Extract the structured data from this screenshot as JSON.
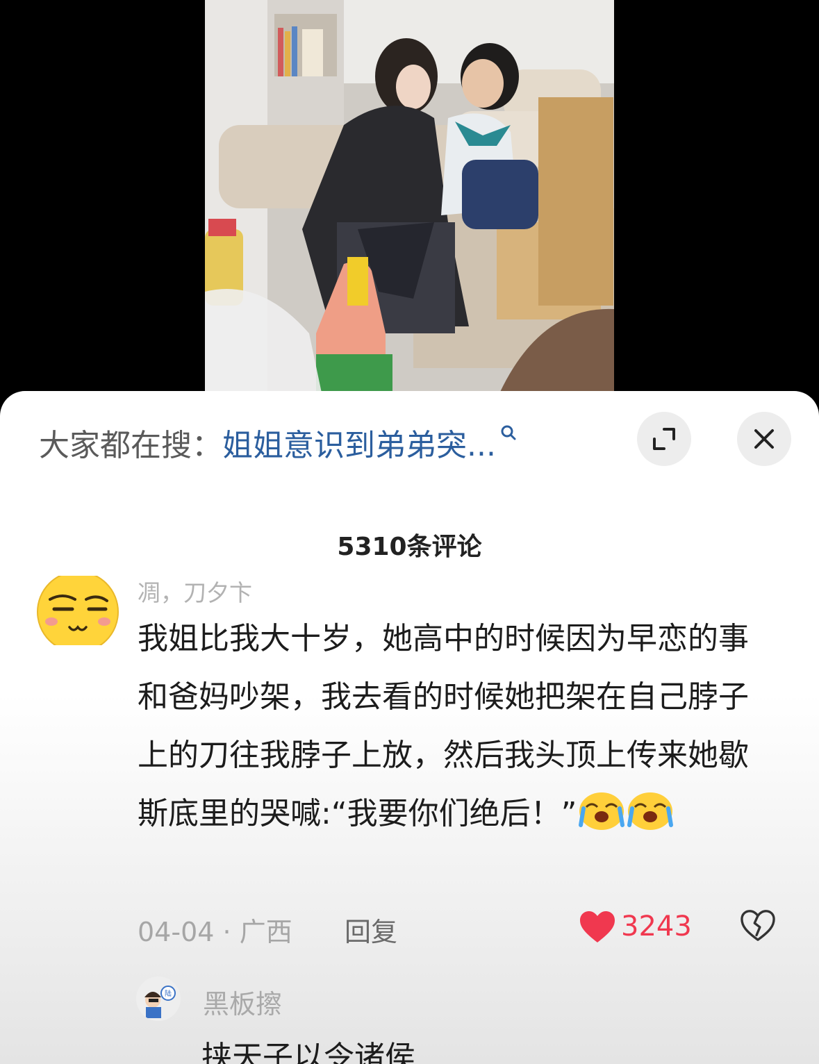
{
  "video": {
    "alt": ""
  },
  "search_bar": {
    "prefix": "大家都在搜：",
    "query": "姐姐意识到弟弟突...",
    "search_icon": "search-icon",
    "expand_icon": "expand-icon",
    "close_icon": "close-icon"
  },
  "comments_header": {
    "count_label": "5310条评论"
  },
  "comments": [
    {
      "username": "凋，刀夕卞",
      "avatar_icon": "smirk-emoji-avatar",
      "text": "我姐比我大十岁，她高中的时候因为早恋的事和爸妈吵架，我去看的时候她把架在自己脖子上的刀往我脖子上放，然后我头顶上传来她歇斯底里的哭喊:“我要你们绝后！”",
      "emojis": [
        "crying-emoji",
        "crying-emoji"
      ],
      "date": "04-04",
      "separator": "·",
      "location": "广西",
      "reply_label": "回复",
      "likes": "3243",
      "like_color": "#f0384f"
    },
    {
      "username": "黑板擦",
      "avatar_icon": "cartoon-avatar",
      "text": "挟天子以令诸侯"
    }
  ]
}
